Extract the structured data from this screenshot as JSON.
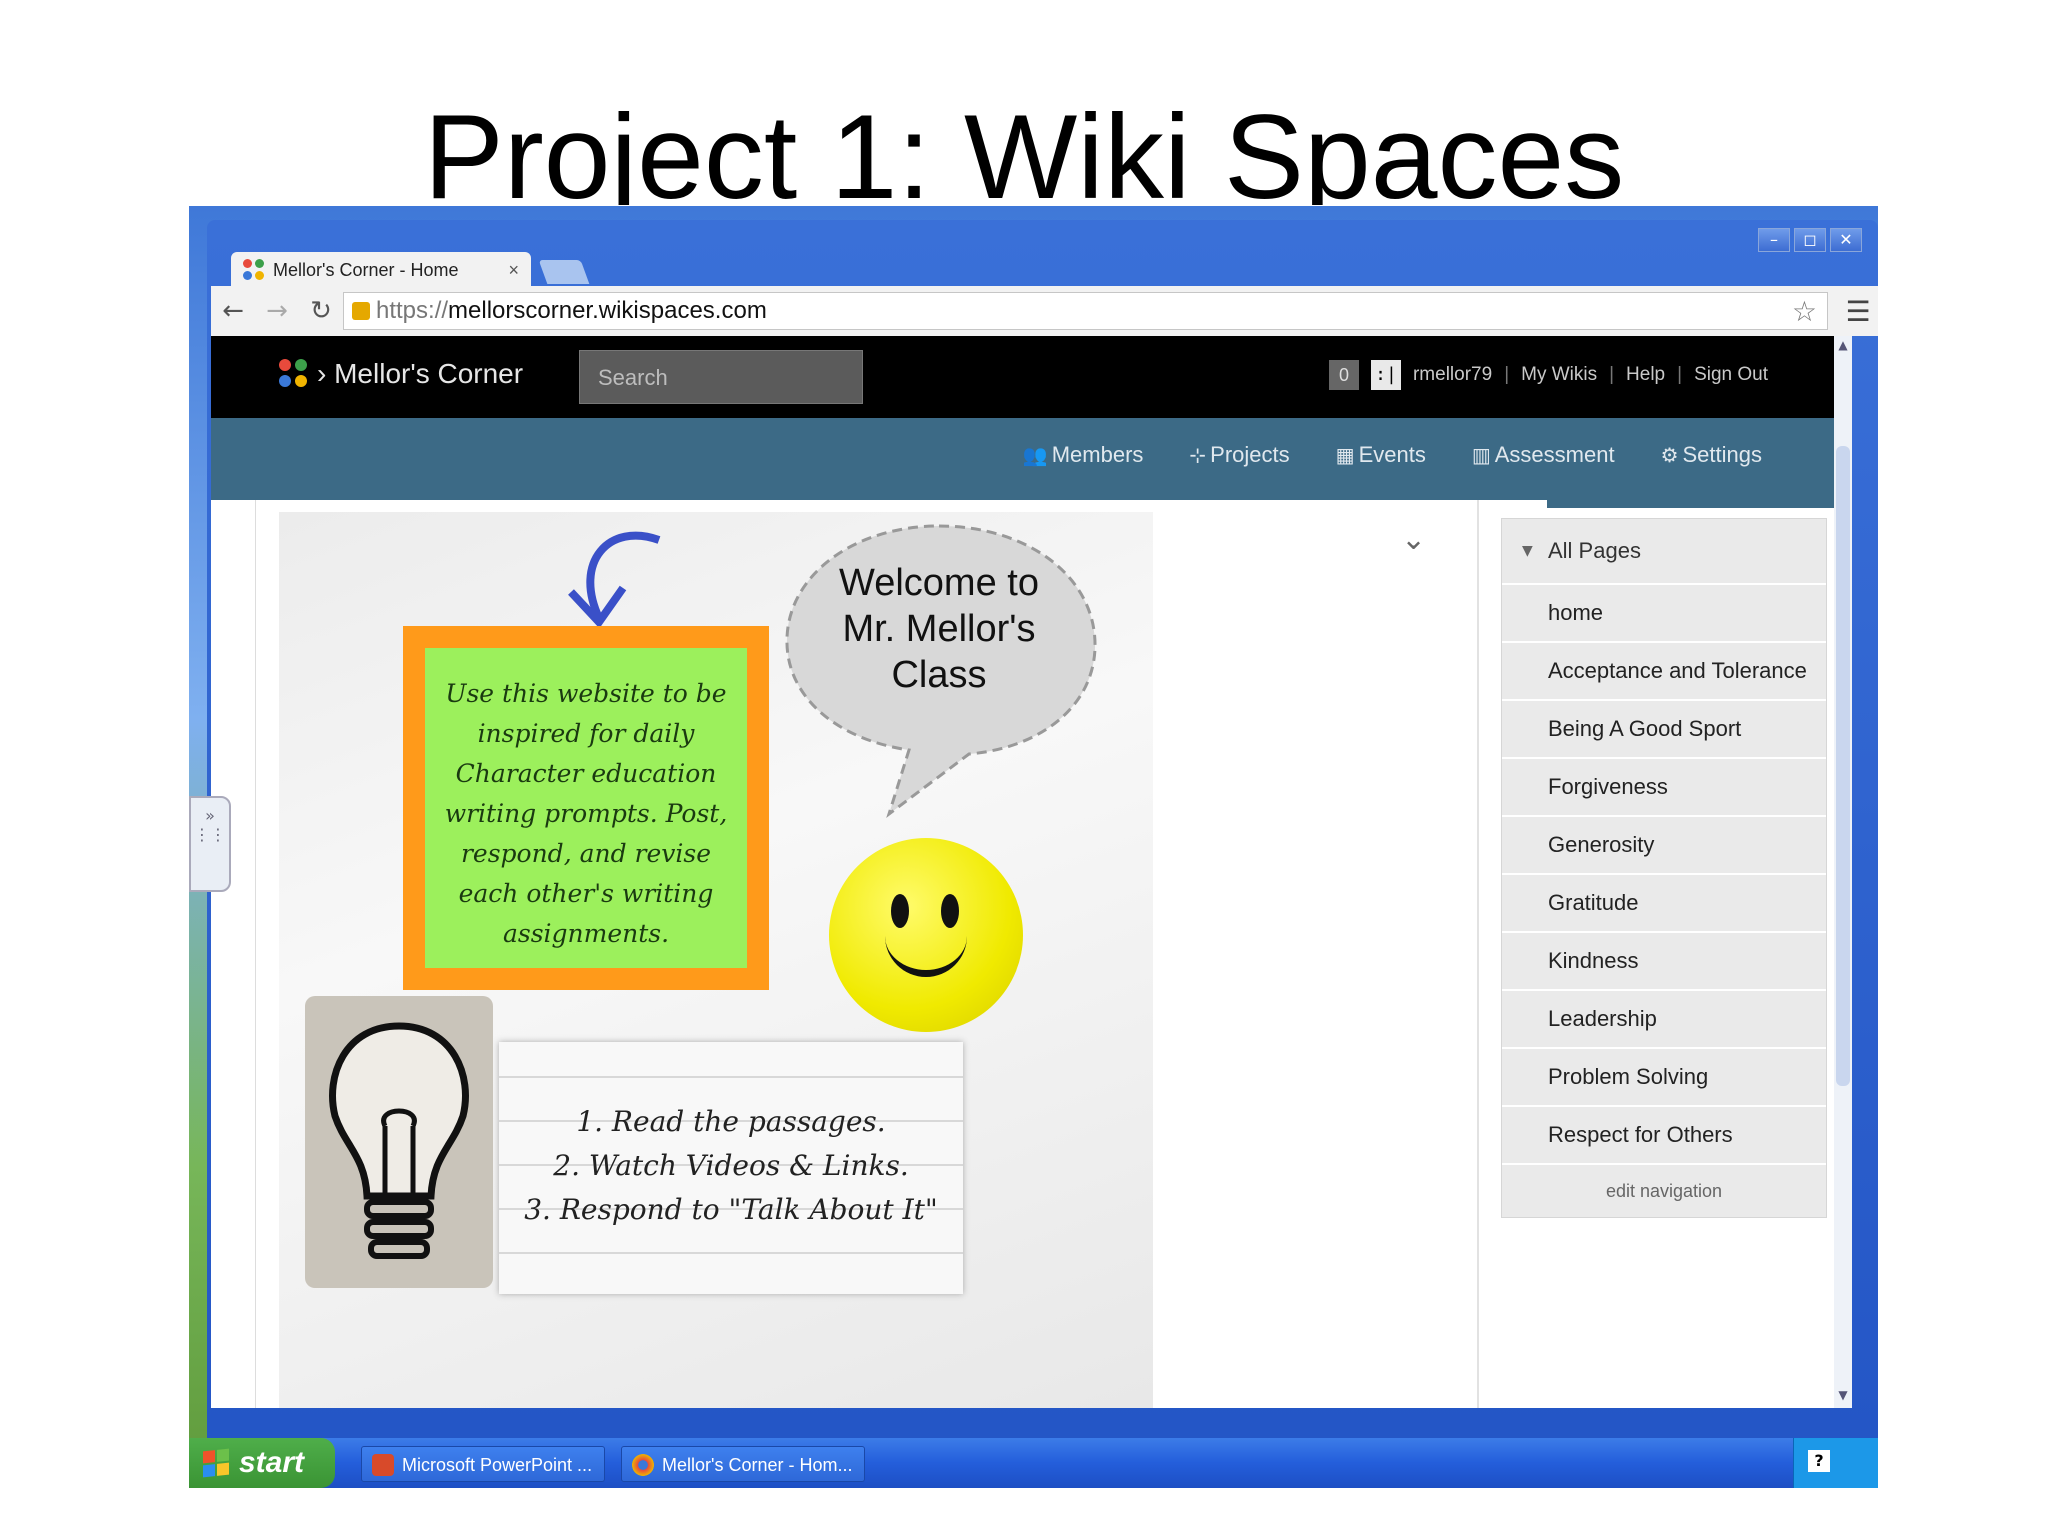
{
  "slide": {
    "title": "Project 1: Wiki Spaces"
  },
  "browser": {
    "tab_title": "Mellor's Corner - Home",
    "tab_close": "×",
    "url_scheme": "https://",
    "url_host": "mellorscorner.wikispaces.com",
    "window_controls": [
      "–",
      "◻",
      "✕"
    ]
  },
  "site": {
    "name": "Mellor's Corner",
    "search_placeholder": "Search",
    "notification_count": "0",
    "username": "rmellor79",
    "user_links": [
      "My Wikis",
      "Help",
      "Sign Out"
    ],
    "nav": [
      {
        "label": "Members",
        "icon": "members-icon"
      },
      {
        "label": "Projects",
        "icon": "projects-icon"
      },
      {
        "label": "Events",
        "icon": "events-icon"
      },
      {
        "label": "Assessment",
        "icon": "assessment-icon"
      },
      {
        "label": "Settings",
        "icon": "settings-icon"
      }
    ]
  },
  "content": {
    "sticky_note": "Use this website to be inspired for daily Character education writing prompts. Post, respond, and revise each other's writing assignments.",
    "welcome_bubble": "Welcome to Mr. Mellor's Class",
    "steps": [
      "1. Read the passages.",
      "2. Watch Videos & Links.",
      "3. Respond to \"Talk About It\""
    ]
  },
  "sidebar": {
    "header": "All Pages",
    "pages": [
      "home",
      "Acceptance and Tolerance",
      "Being A Good Sport",
      "Forgiveness",
      "Generosity",
      "Gratitude",
      "Kindness",
      "Leadership",
      "Problem Solving",
      "Respect for Others"
    ],
    "edit_link": "edit navigation"
  },
  "taskbar": {
    "start_label": "start",
    "tasks": [
      "Microsoft PowerPoint ...",
      "Mellor's Corner - Hom..."
    ]
  },
  "colors": {
    "topbar": "#000000",
    "navbar": "#3c6a86",
    "sticky_fill": "#9cf05c",
    "sticky_border": "#ff9a1a",
    "smiley": "#f0ea00"
  }
}
